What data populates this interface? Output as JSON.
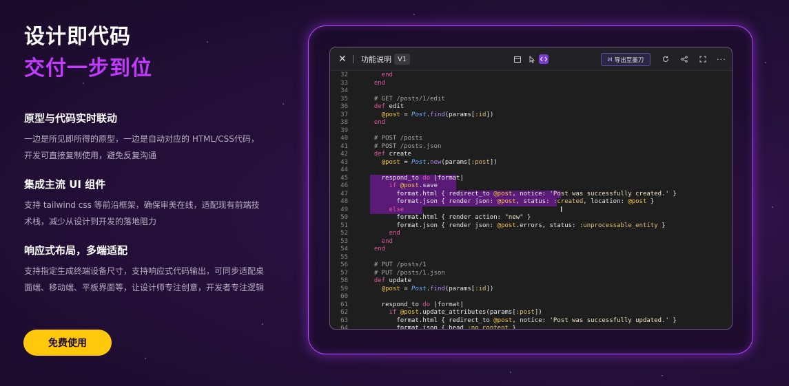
{
  "hero": {
    "line1": "设计即代码",
    "line2": "交付一步到位"
  },
  "features": [
    {
      "title": "原型与代码实时联动",
      "desc": "一边是所见即所得的原型，一边是自动对应的 HTML/CSS代码，开发可直接复制使用，避免反复沟通"
    },
    {
      "title": "集成主流 UI 组件",
      "desc": "支持 tailwind css 等前沿框架，确保审美在线，适配现有前端技术栈，减少从设计到开发的落地阻力"
    },
    {
      "title": "响应式布局，多端适配",
      "desc": "支持指定生成终端设备尺寸，支持响应式代码输出，可同步适配桌面端、移动端、平板界面等，让设计师专注创意，开发者专注逻辑"
    }
  ],
  "cta": {
    "label": "免费使用"
  },
  "window": {
    "title": "功能说明",
    "version": "V1",
    "export_label": "导出至墨刀",
    "icons": [
      "close-icon",
      "frame-icon",
      "pointer-icon",
      "code-icon",
      "refresh-icon",
      "share-icon",
      "fullscreen-icon",
      "more-icon"
    ]
  },
  "code_lines": [
    {
      "n": "32",
      "t": "    end"
    },
    {
      "n": "33",
      "t": "  end"
    },
    {
      "n": "34",
      "t": ""
    },
    {
      "n": "35",
      "t": "  # GET /posts/1/edit"
    },
    {
      "n": "36",
      "t": "  def edit"
    },
    {
      "n": "37",
      "t": "    @post = Post.find(params[:id])"
    },
    {
      "n": "38",
      "t": "  end"
    },
    {
      "n": "39",
      "t": ""
    },
    {
      "n": "40",
      "t": "  # POST /posts"
    },
    {
      "n": "41",
      "t": "  # POST /posts.json"
    },
    {
      "n": "42",
      "t": "  def create"
    },
    {
      "n": "43",
      "t": "    @post = Post.new(params[:post])"
    },
    {
      "n": "44",
      "t": ""
    },
    {
      "n": "45",
      "t": "    respond_to do |format|"
    },
    {
      "n": "46",
      "t": "      if @post.save"
    },
    {
      "n": "47",
      "t": "        format.html { redirect_to @post, notice: 'Post was successfully created.' }"
    },
    {
      "n": "48",
      "t": "        format.json { render json: @post, status: :created, location: @post }"
    },
    {
      "n": "49",
      "t": "      else"
    },
    {
      "n": "50",
      "t": "        format.html { render action: \"new\" }"
    },
    {
      "n": "51",
      "t": "        format.json { render json: @post.errors, status: :unprocessable_entity }"
    },
    {
      "n": "52",
      "t": "      end"
    },
    {
      "n": "53",
      "t": "    end"
    },
    {
      "n": "54",
      "t": "  end"
    },
    {
      "n": "55",
      "t": ""
    },
    {
      "n": "56",
      "t": "  # PUT /posts/1"
    },
    {
      "n": "57",
      "t": "  # PUT /posts/1.json"
    },
    {
      "n": "58",
      "t": "  def update"
    },
    {
      "n": "59",
      "t": "    @post = Post.find(params[:id])"
    },
    {
      "n": "60",
      "t": ""
    },
    {
      "n": "61",
      "t": "    respond_to do |format|"
    },
    {
      "n": "62",
      "t": "      if @post.update_attributes(params[:post])"
    },
    {
      "n": "63",
      "t": "        format.html { redirect_to @post, notice: 'Post was successfully updated.' }"
    },
    {
      "n": "64",
      "t": "        format.json { head :no_content }"
    }
  ],
  "colors": {
    "accent": "#c23bff",
    "cta": "#ffc80a",
    "selection": "#5a1a78"
  }
}
